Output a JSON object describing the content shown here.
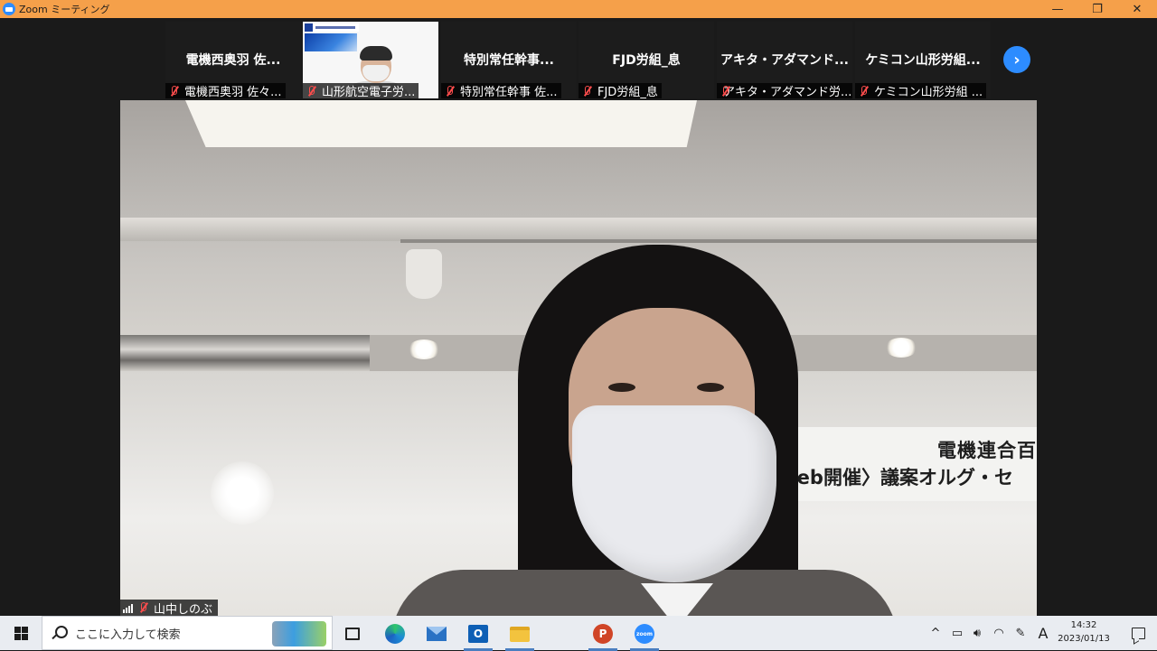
{
  "window": {
    "title": "Zoom ミーティング",
    "minimize_glyph": "—",
    "maximize_glyph": "❐",
    "close_glyph": "✕"
  },
  "gallery": {
    "tiles": [
      {
        "name": "電機西奥羽 佐...",
        "label": "電機西奥羽 佐々...",
        "video": false
      },
      {
        "name": "",
        "label": "山形航空電子労...",
        "video": true
      },
      {
        "name": "特別常任幹事...",
        "label": "特別常任幹事 佐...",
        "video": false
      },
      {
        "name": "FJD労組_息",
        "label": "FJD労組_息",
        "video": false
      },
      {
        "name": "アキタ・アダマンド...",
        "label": "アキタ・アダマンド労...",
        "video": false
      },
      {
        "name": "ケミコン山形労組...",
        "label": "ケミコン山形労組 ...",
        "video": false
      }
    ],
    "next_icon": "chevron-right-icon",
    "next_glyph": "›"
  },
  "speaker": {
    "name": "山中しのぶ",
    "banner_line1": "電機連合百",
    "banner_line2": "/eb開催〉議案オルグ・セ"
  },
  "taskbar": {
    "search_placeholder": "ここに入力して検索",
    "outlook_glyph": "O",
    "ppt_glyph": "P",
    "zoom_glyph": "zoom",
    "tray_chevron": "^",
    "ime_mode": "A",
    "time": "14:32",
    "date": "2023/01/13"
  },
  "colors": {
    "titlebar": "#f5a04a",
    "zoom_blue": "#2d8cff",
    "muted_red": "#ff4d4d",
    "taskbar": "#e9ecf1"
  }
}
